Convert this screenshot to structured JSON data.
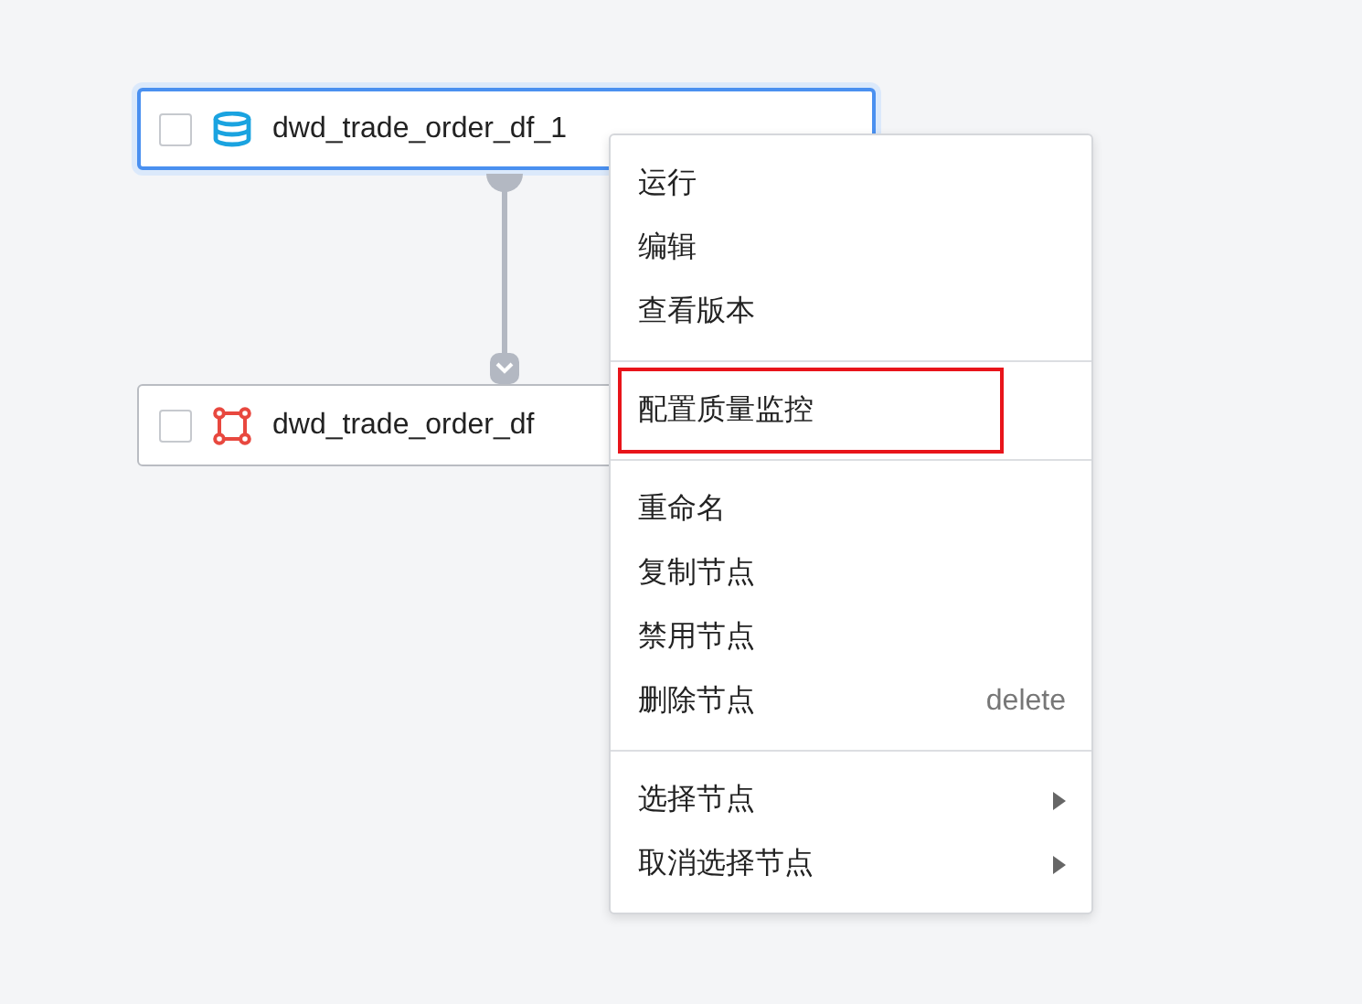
{
  "canvas": {
    "nodes": [
      {
        "label": "dwd_trade_order_df_1",
        "kind": "database",
        "selected": true,
        "checked": false
      },
      {
        "label": "dwd_trade_order_df",
        "kind": "transform",
        "selected": false,
        "checked": false
      }
    ]
  },
  "context_menu": {
    "groups": [
      {
        "items": [
          {
            "label": "运行",
            "marked": false
          },
          {
            "label": "编辑",
            "marked": false
          },
          {
            "label": "查看版本",
            "marked": false
          }
        ]
      },
      {
        "items": [
          {
            "label": "配置质量监控",
            "marked": true
          }
        ]
      },
      {
        "items": [
          {
            "label": "重命名",
            "marked": false
          },
          {
            "label": "复制节点",
            "marked": false
          },
          {
            "label": "禁用节点",
            "marked": false
          },
          {
            "label": "删除节点",
            "shortcut": "delete",
            "marked": false
          }
        ]
      },
      {
        "items": [
          {
            "label": "选择节点",
            "submenu": true,
            "marked": false
          },
          {
            "label": "取消选择节点",
            "submenu": true,
            "marked": false
          }
        ]
      }
    ]
  }
}
